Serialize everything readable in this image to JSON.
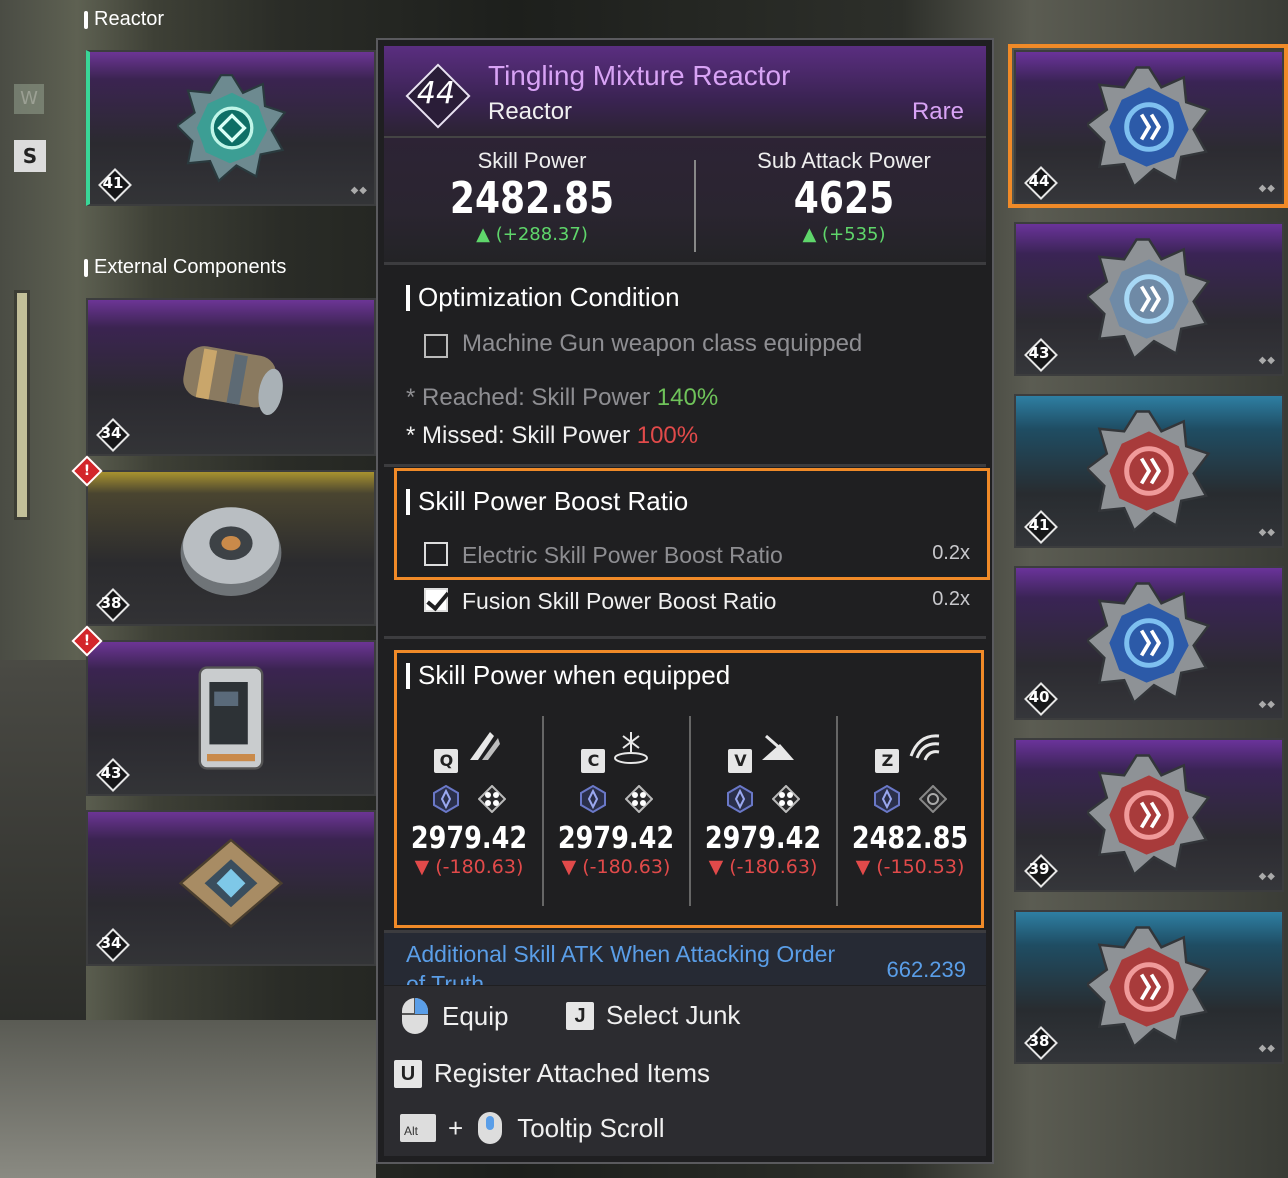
{
  "left_panel": {
    "reactor_label": "Reactor",
    "external_label": "External Components",
    "hotkeys": {
      "w": "W",
      "s": "S"
    },
    "reactor_card": {
      "level": "41"
    },
    "components": [
      {
        "level": "34",
        "warning": false,
        "style": "purple"
      },
      {
        "level": "38",
        "warning": true,
        "style": "gold"
      },
      {
        "level": "43",
        "warning": true,
        "style": "purple"
      },
      {
        "level": "34",
        "warning": false,
        "style": "purple"
      }
    ]
  },
  "tooltip": {
    "level": "44",
    "name": "Tingling Mixture Reactor",
    "type": "Reactor",
    "rarity": "Rare",
    "stats": [
      {
        "label": "Skill Power",
        "value": "2482.85",
        "delta": "(+288.37)"
      },
      {
        "label": "Sub Attack Power",
        "value": "4625",
        "delta": "(+535)"
      }
    ],
    "optimization": {
      "title": "Optimization Condition",
      "condition": "Machine Gun weapon class equipped",
      "reached_prefix": "* Reached: Skill Power ",
      "reached_value": "140%",
      "missed_prefix": "* Missed: Skill Power ",
      "missed_value": "100%"
    },
    "boost": {
      "title": "Skill Power Boost Ratio",
      "rows": [
        {
          "label": "Electric Skill Power Boost Ratio",
          "value": "0.2x",
          "checked": false
        },
        {
          "label": "Fusion Skill Power Boost Ratio",
          "value": "0.2x",
          "checked": true
        }
      ]
    },
    "equipped": {
      "title": "Skill Power when equipped",
      "skills": [
        {
          "key": "Q",
          "icon": "slash-skill-icon",
          "value": "2979.42",
          "delta": "(-180.63)"
        },
        {
          "key": "C",
          "icon": "frost-skill-icon",
          "value": "2979.42",
          "delta": "(-180.63)"
        },
        {
          "key": "V",
          "icon": "strike-skill-icon",
          "value": "2979.42",
          "delta": "(-180.63)"
        },
        {
          "key": "Z",
          "icon": "wave-skill-icon",
          "value": "2482.85",
          "delta": "(-150.53)"
        }
      ]
    },
    "additional": {
      "label": "Additional Skill ATK When Attacking Order",
      "label2": "of Truth",
      "value": "662.239"
    },
    "footer": {
      "equip": "Equip",
      "junk_key": "J",
      "junk": "Select Junk",
      "register_key": "U",
      "register": "Register Attached Items",
      "alt_key": "Alt",
      "plus": "+",
      "scroll": "Tooltip Scroll"
    }
  },
  "right_list": [
    {
      "level": "44",
      "style": "purple",
      "gem": "blue",
      "selected": true
    },
    {
      "level": "43",
      "style": "purple",
      "gem": "lightblue",
      "selected": false
    },
    {
      "level": "41",
      "style": "blue",
      "gem": "red",
      "selected": false
    },
    {
      "level": "40",
      "style": "purple",
      "gem": "blue",
      "selected": false
    },
    {
      "level": "39",
      "style": "purple",
      "gem": "red",
      "selected": false
    },
    {
      "level": "38",
      "style": "blue",
      "gem": "red",
      "selected": false
    }
  ],
  "colors": {
    "accent_orange": "#f08a28",
    "rare_purple": "#d8a3f5",
    "up_green": "#5fd66b",
    "down_red": "#e14a4a"
  }
}
